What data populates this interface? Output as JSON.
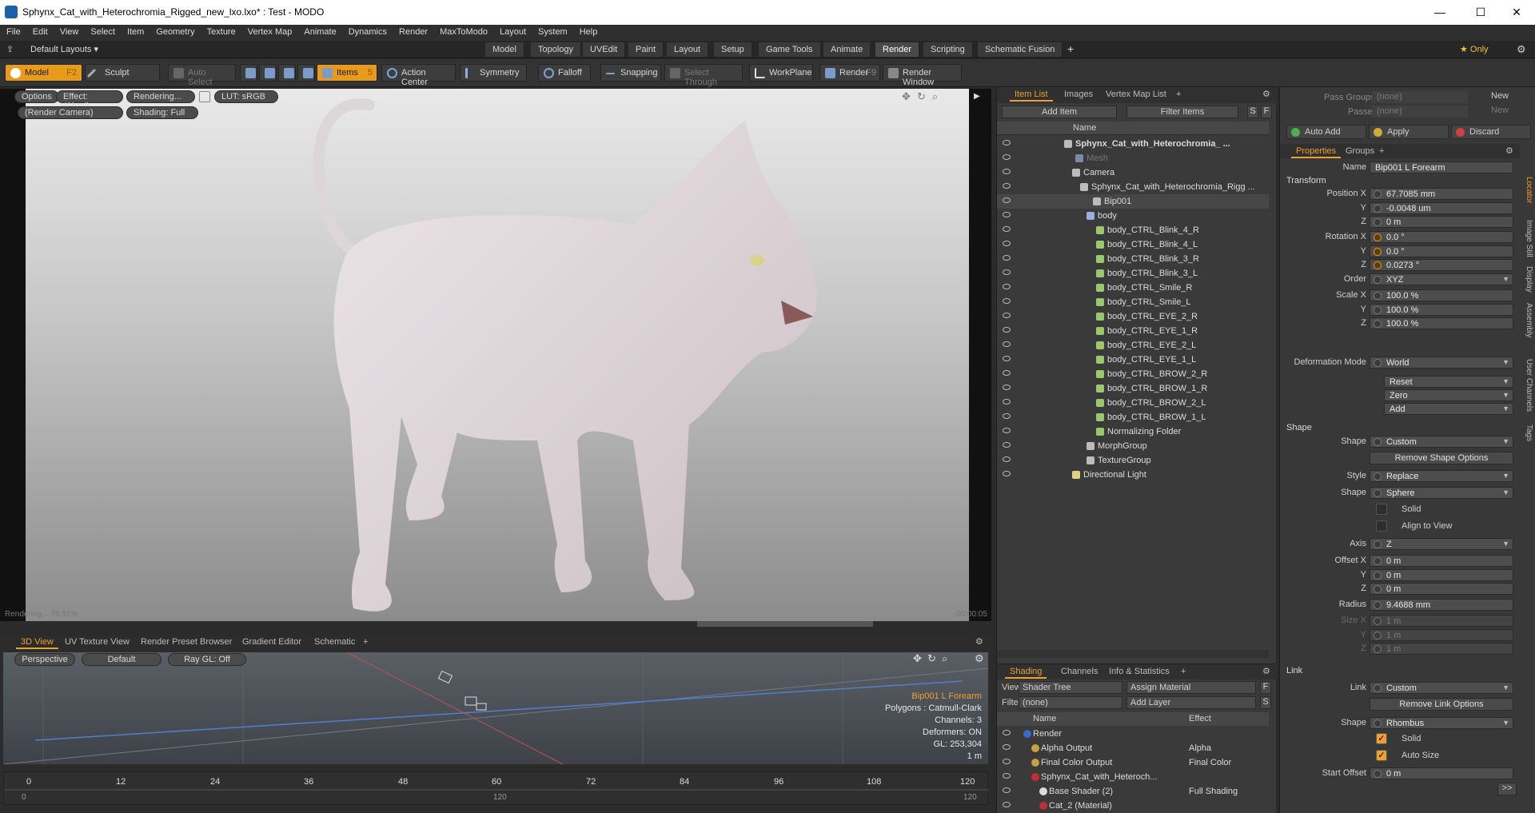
{
  "titlebar": {
    "title": "Sphynx_Cat_with_Heterochromia_Rigged_new_lxo.lxo* : Test - MODO",
    "minimize": "—",
    "maximize": "☐",
    "close": "✕"
  },
  "menu": [
    "File",
    "Edit",
    "View",
    "Select",
    "Item",
    "Geometry",
    "Texture",
    "Vertex Map",
    "Animate",
    "Dynamics",
    "Render",
    "MaxToModo",
    "Layout",
    "System",
    "Help"
  ],
  "layoutbar": {
    "layouts": "Default Layouts ▾",
    "tabs": [
      "Model",
      "Topology",
      "UVEdit",
      "Paint",
      "Layout",
      "Setup",
      "Game Tools",
      "Animate",
      "Render",
      "Scripting",
      "Schematic Fusion"
    ],
    "add": "+",
    "only": "★ Only"
  },
  "toolbar": {
    "model": "Model",
    "model_key": "F2",
    "sculpt": "Sculpt",
    "auto_select": "Auto Select",
    "items": "Items",
    "items_key": "5",
    "action_center": "Action Center",
    "symmetry": "Symmetry",
    "falloff": "Falloff",
    "snapping": "Snapping",
    "select_through": "Select Through",
    "workplane": "WorkPlane",
    "render": "Render",
    "render_key": "F9",
    "render_window": "Render Window"
  },
  "viewport": {
    "options": "Options",
    "effect": "Effect: (Shadi...",
    "rendering": "Rendering...",
    "lut": "LUT: sRGB",
    "camera": "(Render Camera)",
    "shading": "Shading: Full",
    "progress": "Rendering... 79.51%",
    "time": "00:00:05"
  },
  "bottom_tabs": [
    "3D View",
    "UV Texture View",
    "Render Preset Browser",
    "Gradient Editor",
    "Schematic",
    "+"
  ],
  "view3d": {
    "perspective": "Perspective",
    "default": "Default",
    "raygl": "Ray GL: Off",
    "info": [
      "Bip001 L Forearm",
      "Polygons : Catmull-Clark",
      "Channels: 3",
      "Deformers: ON",
      "GL: 253,304",
      "1 m"
    ]
  },
  "timeline": {
    "ticks": [
      "0",
      "12",
      "24",
      "36",
      "48",
      "60",
      "72",
      "84",
      "96",
      "108",
      "120"
    ],
    "sub_ticks": [
      "0",
      "120",
      "120"
    ]
  },
  "itemlist": {
    "tabs": [
      "Item List",
      "Images",
      "Vertex Map List",
      "+"
    ],
    "add_item": "Add Item",
    "filter_items": "Filter Items",
    "s": "S",
    "f": "F",
    "col_name": "Name",
    "rows": [
      "Sphynx_Cat_with_Heterochromia_ ...",
      "Mesh",
      "Camera",
      "Sphynx_Cat_with_Heterochromia_Rigg ...",
      "Bip001",
      "body",
      "body_CTRL_Blink_4_R",
      "body_CTRL_Blink_4_L",
      "body_CTRL_Blink_3_R",
      "body_CTRL_Blink_3_L",
      "body_CTRL_Smile_R",
      "body_CTRL_Smile_L",
      "body_CTRL_EYE_2_R",
      "body_CTRL_EYE_1_R",
      "body_CTRL_EYE_2_L",
      "body_CTRL_EYE_1_L",
      "body_CTRL_BROW_2_R",
      "body_CTRL_BROW_1_R",
      "body_CTRL_BROW_2_L",
      "body_CTRL_BROW_1_L",
      "Normalizing Folder",
      "MorphGroup",
      "TextureGroup",
      "Directional Light"
    ]
  },
  "shading": {
    "tabs": [
      "Shading",
      "Channels",
      "Info & Statistics",
      "+"
    ],
    "view_label": "View",
    "view_value": "Shader Tree",
    "assign": "Assign Material",
    "f": "F",
    "filter_label": "Filter",
    "filter_value": "(none)",
    "add_layer": "Add Layer",
    "s": "S",
    "col_name": "Name",
    "col_effect": "Effect",
    "rows": [
      {
        "name": "Render",
        "effect": ""
      },
      {
        "name": "Alpha Output",
        "effect": "Alpha"
      },
      {
        "name": "Final Color Output",
        "effect": "Final Color"
      },
      {
        "name": "Sphynx_Cat_with_Heteroch...",
        "effect": ""
      },
      {
        "name": "Base Shader (2)",
        "effect": "Full Shading"
      },
      {
        "name": "Cat_2 (Material)",
        "effect": ""
      }
    ]
  },
  "props": {
    "pass_groups": "Pass Groups",
    "passes": "Passes",
    "none1": "(none)",
    "none2": "(none)",
    "new1": "New",
    "new2": "New",
    "auto_add": "Auto Add",
    "apply": "Apply",
    "discard": "Discard",
    "tabs": [
      "Properties",
      "Groups",
      "+"
    ],
    "name_label": "Name",
    "name_value": "Bip001 L Forearm",
    "transform": "Transform",
    "pos_label": "Position X",
    "pos_x": "67.7085 mm",
    "pos_y": "-0.0048 um",
    "pos_z": "0 m",
    "rot_label": "Rotation X",
    "rot_x": "0.0 °",
    "rot_y": "0.0 °",
    "rot_z": "0.0273 °",
    "order_label": "Order",
    "order": "XYZ",
    "scale_label": "Scale X",
    "scale_x": "100.0 %",
    "scale_y": "100.0 %",
    "scale_z": "100.0 %",
    "y": "Y",
    "z": "Z",
    "deform_label": "Deformation Mode",
    "deform": "World",
    "reset": "Reset",
    "zero": "Zero",
    "add": "Add",
    "shape_section": "Shape",
    "shape_label": "Shape",
    "shape_value": "Custom",
    "remove_shape": "Remove Shape Options",
    "style_label": "Style",
    "style_value": "Replace",
    "shape2_value": "Sphere",
    "solid": "Solid",
    "align": "Align to View",
    "axis_label": "Axis",
    "axis_value": "Z",
    "offset_label": "Offset X",
    "off_x": "0 m",
    "off_y": "0 m",
    "off_z": "0 m",
    "radius_label": "Radius",
    "radius": "9.4688 mm",
    "size_label": "Size X",
    "size_x": "1 m",
    "size_y": "1 m",
    "size_z": "1 m",
    "link_section": "Link",
    "link_label": "Link",
    "link_value": "Custom",
    "remove_link": "Remove Link Options",
    "lshape_label": "Shape",
    "lshape_value": "Rhombus",
    "lsolid": "Solid",
    "autosize": "Auto Size",
    "start_label": "Start Offset",
    "start_value": "0 m",
    "more": ">>",
    "side_tabs": [
      "Locator",
      "Image Still",
      "Display",
      "Assembly",
      "User Channels",
      "Tags"
    ]
  },
  "colors": {
    "accent": "#f0a030",
    "panel": "#3a3a3a"
  }
}
